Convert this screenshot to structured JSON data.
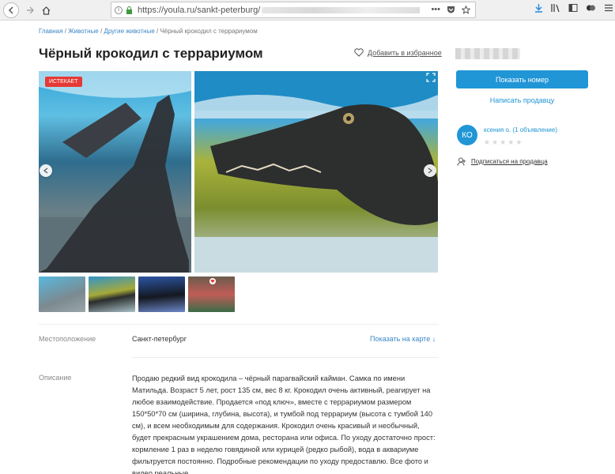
{
  "browser": {
    "url_prefix": "https://youla.ru/sankt-peterburg/"
  },
  "breadcrumb": {
    "items": [
      "Главная",
      "Животные",
      "Другие животные"
    ],
    "current": "Чёрный крокодил с террариумом"
  },
  "product": {
    "title": "Чёрный крокодил с террариумом",
    "favorite_label": "Добавить в избранное",
    "badge": "ИСТЕКАЕТ"
  },
  "details": {
    "location_label": "Местоположение",
    "location_value": "Санкт-петербург",
    "map_link": "Показать на карте ↓",
    "description_label": "Описание",
    "description_text": "Продаю редкий вид крокодила – чёрный парагвайский кайман. Самка по имени Матильда. Возраст 5 лет, рост 135 см, вес 8 кг. Крокодил очень активный, реагирует на любое взаимодействие. Продается «под ключ», вместе с террариумом размером 150*50*70 см (ширина, глубина, высота), и тумбой под террариум (высота с тумбой 140 см), и всем необходимым для содержания. Крокодил очень красивый и необычный, будет прекрасным украшением дома, ресторана или офиса. По уходу достаточно прост: кормление 1 раз в неделю говядиной или курицей (редко рыбой), вода в аквариуме фильтруется постоянно. Подробные рекомендации по уходу предоставлю. Все фото и видео реальные."
  },
  "sidebar": {
    "show_number": "Показать номер",
    "write_seller": "Написать продавцу",
    "avatar_initials": "КО",
    "seller_name": "ксения о. (1 объявление)",
    "subscribe": "Подписаться на продавца"
  },
  "colors": {
    "accent": "#2196d6",
    "badge": "#e53935",
    "link": "#3a87c6"
  }
}
